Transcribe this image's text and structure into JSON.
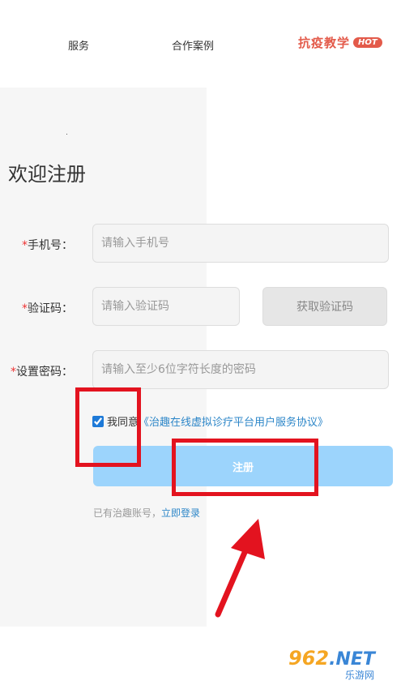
{
  "nav": {
    "services": "服务",
    "cases": "合作案例",
    "hot_text": "抗疫教学",
    "hot_badge": "HOT"
  },
  "form": {
    "title": "欢迎注册",
    "required_mark": "*",
    "phone_label": "手机号：",
    "phone_placeholder": "请输入手机号",
    "code_label": "验证码：",
    "code_placeholder": "请输入验证码",
    "get_code_button": "获取验证码",
    "password_label": "设置密码：",
    "password_placeholder": "请输入至少6位字符长度的密码",
    "agree_text": "我同意",
    "agreement_link": "《治趣在线虚拟诊疗平台用户服务协议》",
    "submit_label": "注册",
    "has_account": "已有治趣账号，",
    "login_link": "立即登录"
  },
  "watermark": {
    "number": "962",
    "domain": ".NET",
    "sub": "乐游网"
  },
  "colors": {
    "accent": "#e35a4a",
    "link": "#2c86c8",
    "submit_bg": "#9cd4fc",
    "highlight": "#e3131f"
  }
}
